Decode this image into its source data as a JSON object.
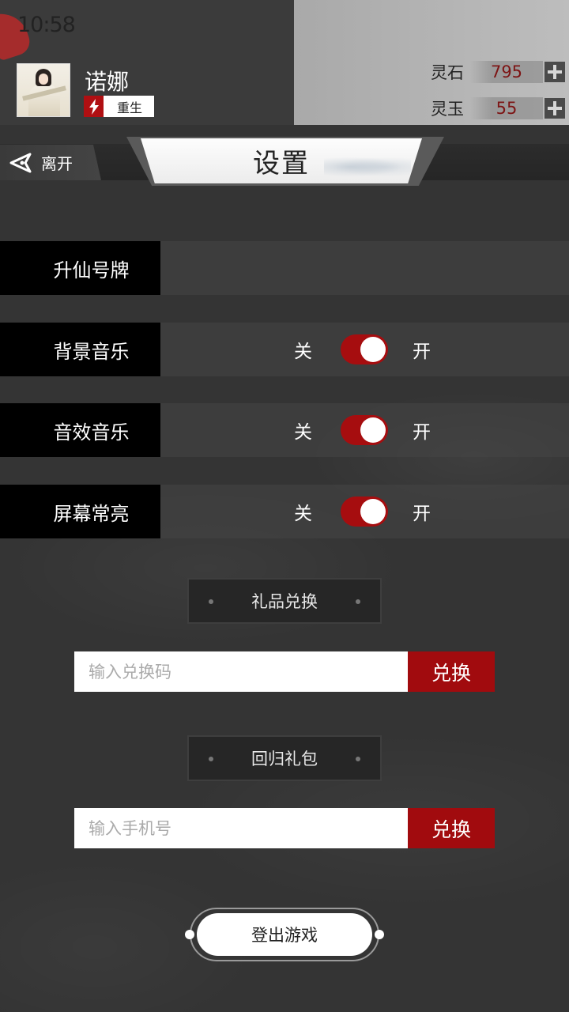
{
  "status_bar": {
    "time": "10:58"
  },
  "player": {
    "name": "诺娜",
    "badge_label": "重生",
    "badge_icon": "lightning-icon"
  },
  "currencies": [
    {
      "label": "灵石",
      "value": "795"
    },
    {
      "label": "灵玉",
      "value": "55"
    }
  ],
  "nav": {
    "leave_label": "离开"
  },
  "page": {
    "title": "设置"
  },
  "settings": {
    "ascension_label": "升仙号牌",
    "rows": [
      {
        "label": "背景音乐",
        "off": "关",
        "on": "开",
        "enabled": true
      },
      {
        "label": "音效音乐",
        "off": "关",
        "on": "开",
        "enabled": true
      },
      {
        "label": "屏幕常亮",
        "off": "关",
        "on": "开",
        "enabled": true
      }
    ]
  },
  "gift_redeem": {
    "title": "礼品兑换",
    "placeholder": "输入兑换码",
    "value": "",
    "button": "兑换"
  },
  "return_gift": {
    "title": "回归礼包",
    "placeholder": "输入手机号",
    "value": "",
    "button": "兑换"
  },
  "logout": {
    "label": "登出游戏"
  },
  "colors": {
    "accent": "#a60d0f",
    "currency_text": "#7d1414"
  }
}
